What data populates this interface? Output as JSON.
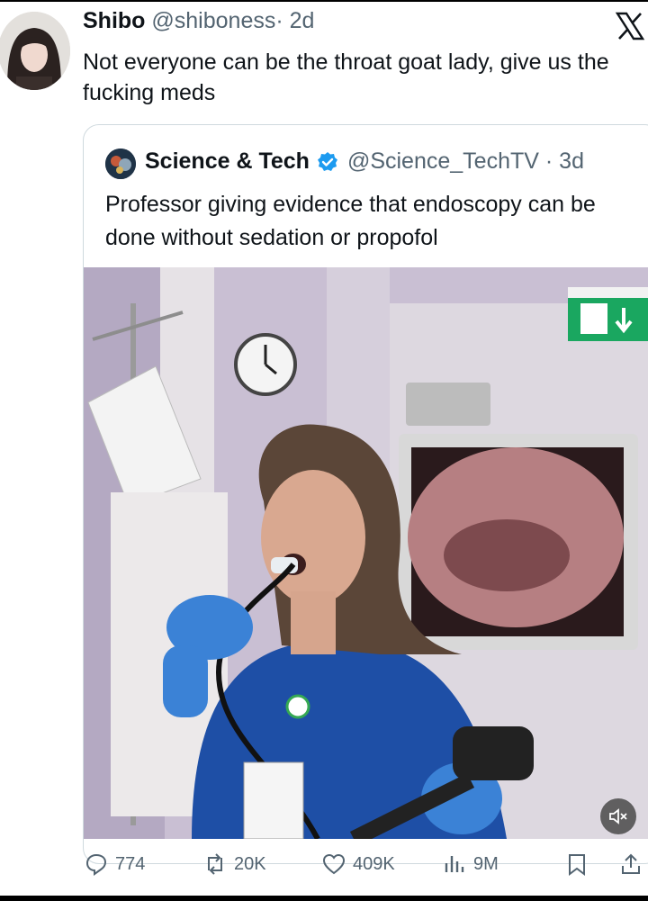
{
  "tweet": {
    "display_name": "Shibo",
    "handle": "@shiboness",
    "time": "· 2d",
    "text": "Not everyone can be the throat goat lady, give us the fucking meds"
  },
  "quoted_tweet": {
    "display_name": "Science & Tech",
    "handle": "@Science_TechTV",
    "time": "· 3d",
    "text": "Professor giving evidence that endoscopy can be done without sedation or propofol"
  },
  "media": {
    "type": "video",
    "description_icons": [
      "exit-sign-icon",
      "wall-clock",
      "endoscopy-monitor"
    ]
  },
  "actions": {
    "replies": "774",
    "reposts": "20K",
    "likes": "409K",
    "views": "9M"
  },
  "colors": {
    "text_primary": "#0f1419",
    "text_secondary": "#536471",
    "verified_blue": "#1d9bf0",
    "border": "#cfd9de",
    "exit_sign_green": "#1aa760"
  },
  "icons": [
    "x-logo-icon",
    "verified-badge-icon",
    "mute-icon",
    "reply-icon",
    "repost-icon",
    "like-icon",
    "views-icon",
    "bookmark-icon",
    "share-icon"
  ]
}
